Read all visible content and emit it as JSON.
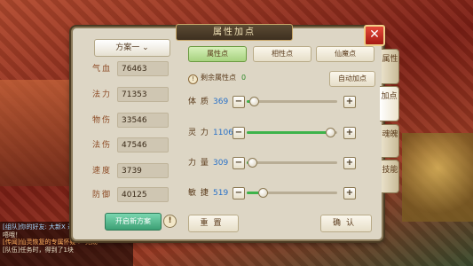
{
  "chat": [
    {
      "text": "[组队]你的好友: 大新X 进",
      "class": "t1"
    },
    {
      "text": "唔哦！",
      "class": ""
    },
    {
      "text": "[传闻]仙灵恢复的专属怀疑 > 完成",
      "class": "t2"
    },
    {
      "text": "[队伍]任务时，得到了1块",
      "class": ""
    }
  ],
  "header": {
    "title": "属性加点",
    "close_label": "✕"
  },
  "left": {
    "plan_label": "方案一 ⌄",
    "stats": [
      {
        "label": "气血",
        "value": "76463"
      },
      {
        "label": "法力",
        "value": "71353"
      },
      {
        "label": "物伤",
        "value": "33546"
      },
      {
        "label": "法伤",
        "value": "47546"
      },
      {
        "label": "速度",
        "value": "3739"
      },
      {
        "label": "防御",
        "value": "40125"
      }
    ],
    "new_plan_label": "开启新方案",
    "info_label": "!"
  },
  "tabs": [
    {
      "label": "属性点",
      "active": true
    },
    {
      "label": "相性点",
      "active": false
    },
    {
      "label": "仙魔点",
      "active": false
    }
  ],
  "remaining": {
    "icon": "!",
    "label": "剩余属性点",
    "value": "0"
  },
  "auto_label": "自动加点",
  "attributes": [
    {
      "name": "体 质",
      "value": "369",
      "fill": 0.08
    },
    {
      "name": "灵 力",
      "value": "1106",
      "fill": 0.92
    },
    {
      "name": "力 量",
      "value": "309",
      "fill": 0.06
    },
    {
      "name": "敏 捷",
      "value": "519",
      "fill": 0.18
    }
  ],
  "reset_label": "重置",
  "confirm_label": "确认",
  "side_tabs": [
    {
      "label": "属性",
      "active": false
    },
    {
      "label": "加点",
      "active": true
    },
    {
      "label": "魂魄",
      "active": false
    },
    {
      "label": "技能",
      "active": false
    }
  ]
}
